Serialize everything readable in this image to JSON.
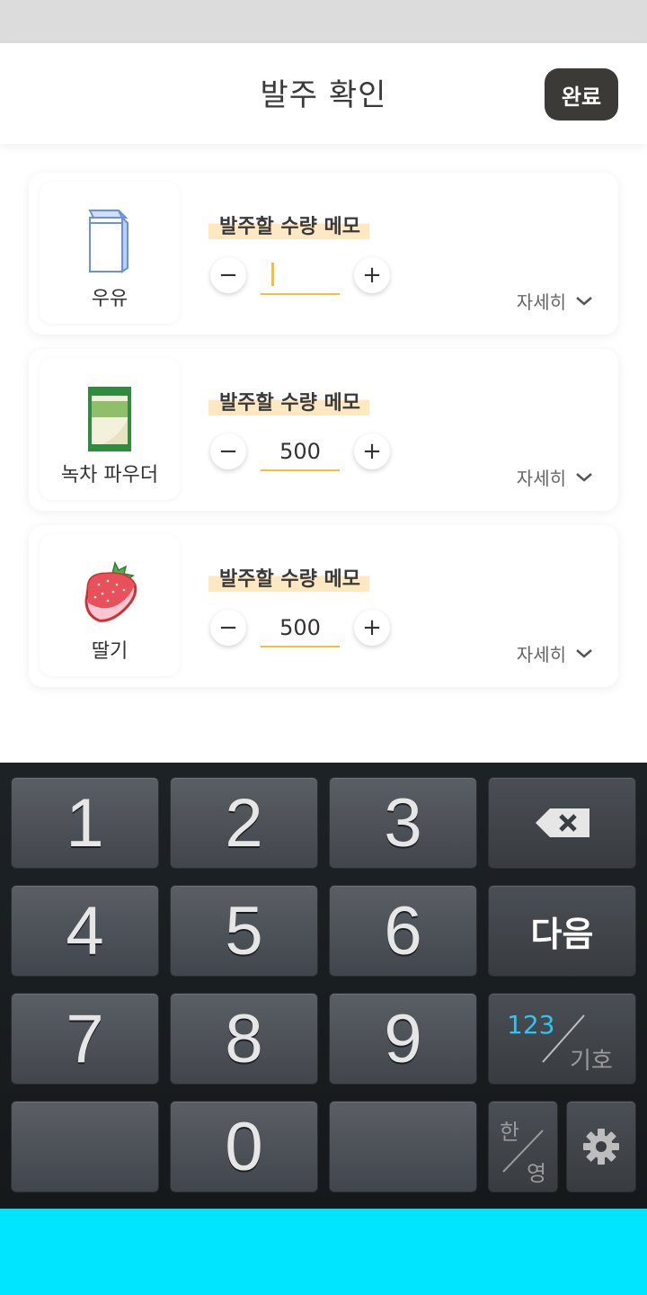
{
  "header": {
    "title": "발주 확인",
    "done_label": "완료"
  },
  "items": [
    {
      "name": "우유",
      "memo_label": "발주할 수량 메모",
      "quantity": "",
      "detail_label": "자세히",
      "icon": "milk-carton-icon"
    },
    {
      "name": "녹차 파우더",
      "memo_label": "발주할 수량 메모",
      "quantity": "500",
      "detail_label": "자세히",
      "icon": "powder-bag-icon"
    },
    {
      "name": "딸기",
      "memo_label": "발주할 수량 메모",
      "quantity": "500",
      "detail_label": "자세히",
      "icon": "strawberry-icon"
    }
  ],
  "stepper": {
    "minus": "−",
    "plus": "+"
  },
  "keyboard": {
    "digits": [
      "1",
      "2",
      "3",
      "4",
      "5",
      "6",
      "7",
      "8",
      "9",
      "0"
    ],
    "next_label": "다음",
    "symbol_toggle": {
      "top": "123",
      "bottom": "기호"
    },
    "lang_toggle": {
      "top": "한",
      "bottom": "영"
    },
    "icons": [
      "backspace-icon",
      "gear-icon"
    ]
  },
  "colors": {
    "accent": "#f2bf3d",
    "highlight": "#fde8c2",
    "done_button": "#3b3a36",
    "bottom_bar": "#00e5ff"
  }
}
